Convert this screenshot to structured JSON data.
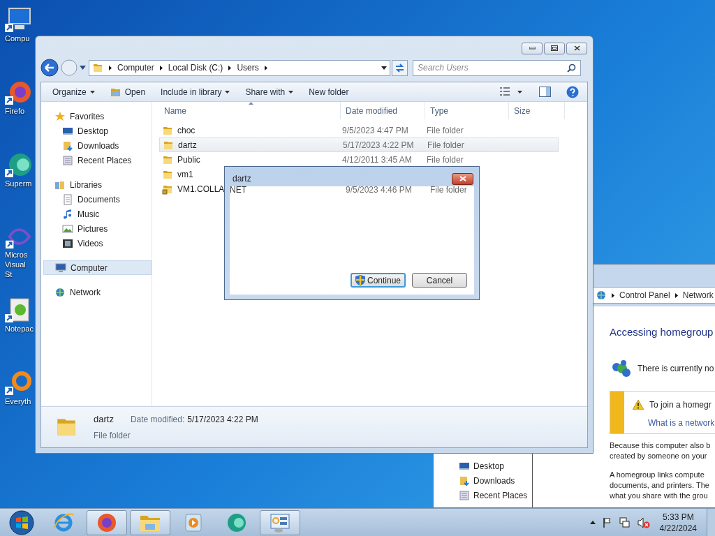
{
  "desktop": {
    "icons": [
      {
        "label": "Compu",
        "kind": "computer"
      },
      {
        "label": "Firefo",
        "kind": "firefox"
      },
      {
        "label": "Superm",
        "kind": "supermium"
      },
      {
        "label": "Micros Visual St",
        "kind": "visualstudio"
      },
      {
        "label": "Notepac",
        "kind": "notepad"
      },
      {
        "label": "Everyth",
        "kind": "everything"
      }
    ]
  },
  "back_window": {
    "breadcrumbs": [
      "Control Panel",
      "Network"
    ],
    "nav_items": [
      "Desktop",
      "Downloads",
      "Recent Places"
    ],
    "heading": "Accessing homegroup",
    "status_text": "There is currently no",
    "warning": {
      "text": "To join a homegr",
      "link": "What is a network"
    },
    "paragraphs": [
      [
        "Because this computer also b",
        "created by someone on your"
      ],
      [
        "A homegroup links compute",
        "documents, and printers. The",
        "what you share with the grou"
      ]
    ]
  },
  "explorer": {
    "breadcrumbs": [
      "Computer",
      "Local Disk (C:)",
      "Users"
    ],
    "search": {
      "placeholder": "Search Users"
    },
    "toolbar": [
      {
        "label": "Organize",
        "kind": "menu"
      },
      {
        "label": "Open",
        "kind": "open"
      },
      {
        "label": "Include in library",
        "kind": "menu"
      },
      {
        "label": "Share with",
        "kind": "menu"
      },
      {
        "label": "New folder",
        "kind": "plain"
      }
    ],
    "nav": [
      {
        "label": "Favorites",
        "kind": "favorites",
        "selected": false,
        "children": [
          {
            "label": "Desktop",
            "kind": "desktop",
            "selected": false
          },
          {
            "label": "Downloads",
            "kind": "downloads",
            "selected": false
          },
          {
            "label": "Recent Places",
            "kind": "recent",
            "selected": false
          }
        ]
      },
      {
        "label": "Libraries",
        "kind": "libraries",
        "selected": false,
        "children": [
          {
            "label": "Documents",
            "kind": "documents",
            "selected": false
          },
          {
            "label": "Music",
            "kind": "music",
            "selected": false
          },
          {
            "label": "Pictures",
            "kind": "pictures",
            "selected": false
          },
          {
            "label": "Videos",
            "kind": "videos",
            "selected": false
          }
        ]
      },
      {
        "label": "Computer",
        "kind": "computer",
        "selected": true
      },
      {
        "label": "Network",
        "kind": "network",
        "selected": false
      }
    ],
    "columns": [
      "Name",
      "Date modified",
      "Type",
      "Size"
    ],
    "rows": [
      {
        "name": "choc",
        "date": "9/5/2023 4:47 PM",
        "type": "File folder",
        "kind": "folder",
        "selected": false
      },
      {
        "name": "dartz",
        "date": "5/17/2023 4:22 PM",
        "type": "File folder",
        "kind": "folder",
        "selected": true
      },
      {
        "name": "Public",
        "date": "4/12/2011 3:45 AM",
        "type": "File folder",
        "kind": "folder",
        "selected": false
      },
      {
        "name": "vm1",
        "kind": "folder",
        "selected": false
      },
      {
        "name": "VM1.COLLA",
        "kind": "locked",
        "selected": false
      }
    ],
    "details": {
      "name": "dartz",
      "date_label": "Date modified:",
      "date": "5/17/2023 4:22 PM",
      "type": "File folder"
    }
  },
  "dialog": {
    "title": "dartz",
    "ghost_row": {
      "name": "NET",
      "date": "9/5/2023 4:46 PM",
      "type": "File folder"
    },
    "buttons": [
      {
        "label": "Continue",
        "kind": "shield",
        "default": true
      },
      {
        "label": "Cancel",
        "kind": "plain",
        "default": false
      }
    ]
  },
  "taskbar": {
    "apps": [
      {
        "kind": "ie",
        "active": false
      },
      {
        "kind": "firefox",
        "active": true
      },
      {
        "kind": "explorer",
        "active": true
      },
      {
        "kind": "media",
        "active": false
      },
      {
        "kind": "supermium",
        "active": false
      },
      {
        "kind": "controlpanel",
        "active": true
      }
    ],
    "time": "5:33 PM",
    "date": "4/22/2024"
  }
}
